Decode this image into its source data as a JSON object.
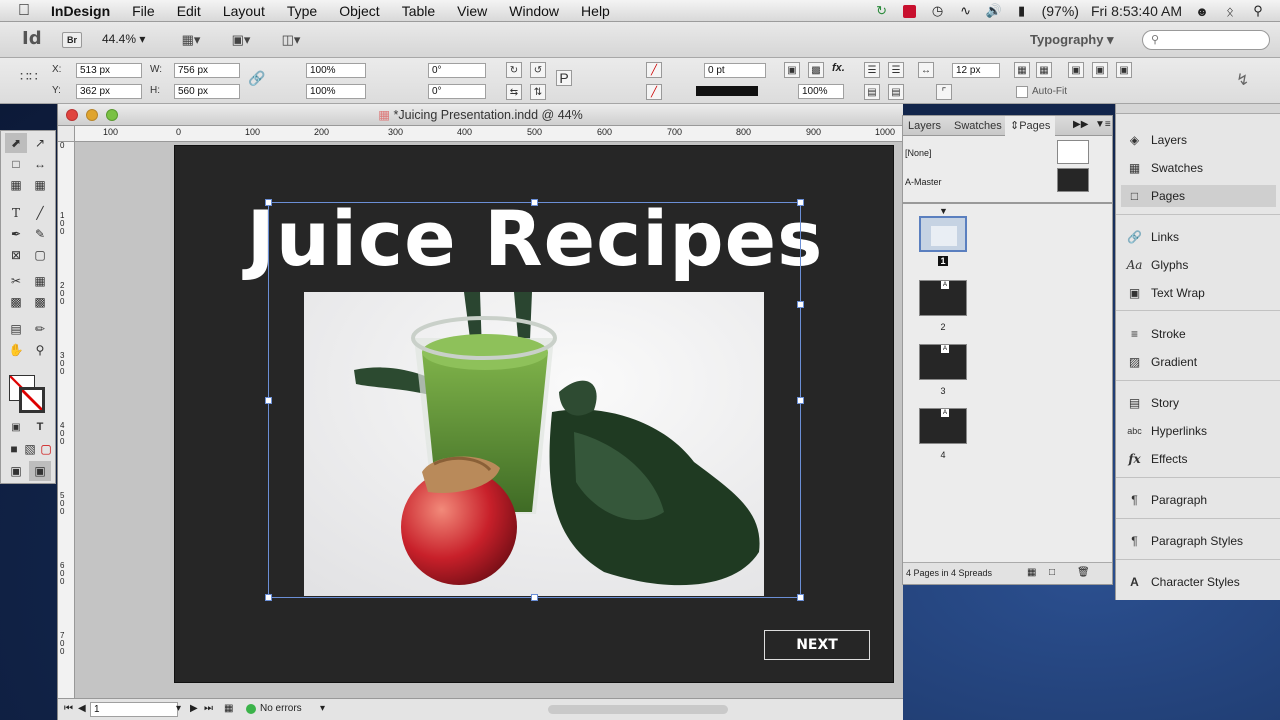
{
  "menubar": {
    "app": "InDesign",
    "items": [
      "File",
      "Edit",
      "Layout",
      "Type",
      "Object",
      "Table",
      "View",
      "Window",
      "Help"
    ],
    "battery": "(97%)",
    "clock": "Fri 8:53:40 AM"
  },
  "appbar": {
    "logo": "Id",
    "bridge": "Br",
    "zoom": "44.4%",
    "workspace": "Typography",
    "search_placeholder": ""
  },
  "control": {
    "x": "513 px",
    "y": "362 px",
    "w": "756 px",
    "h": "560 px",
    "scale_x": "100%",
    "scale_y": "100%",
    "rotate": "0°",
    "shear": "0°",
    "stroke": "0 pt",
    "opacity": "100%",
    "gutter": "12 px",
    "autofit": "Auto-Fit",
    "x_label": "X:",
    "y_label": "Y:",
    "w_label": "W:",
    "h_label": "H:"
  },
  "document": {
    "title": "*Juicing Presentation.indd @ 44%",
    "heading": "Juice Recipes",
    "next_button": "NEXT",
    "ruler_h": [
      "100",
      "0",
      "100",
      "200",
      "300",
      "400",
      "500",
      "600",
      "700",
      "800",
      "900",
      "1000"
    ],
    "ruler_v": [
      "0",
      "1 0 0",
      "2 0 0",
      "3 0 0",
      "4 0 0",
      "5 0 0",
      "6 0 0",
      "7 0 0"
    ],
    "page_field": "1",
    "preflight": "No errors"
  },
  "pages_panel": {
    "tabs": [
      "Layers",
      "Swatches",
      "Pages"
    ],
    "masters": [
      "[None]",
      "A-Master"
    ],
    "pages": [
      "1",
      "2",
      "3",
      "4"
    ],
    "footer": "4 Pages in 4 Spreads"
  },
  "dock": {
    "items": [
      "Layers",
      "Swatches",
      "Pages",
      "Links",
      "Glyphs",
      "Text Wrap",
      "Stroke",
      "Gradient",
      "Story",
      "Hyperlinks",
      "Effects",
      "Paragraph",
      "Paragraph Styles",
      "Character Styles"
    ]
  },
  "colors": {
    "page_bg": "#262626",
    "selection": "#6b8fd6"
  }
}
